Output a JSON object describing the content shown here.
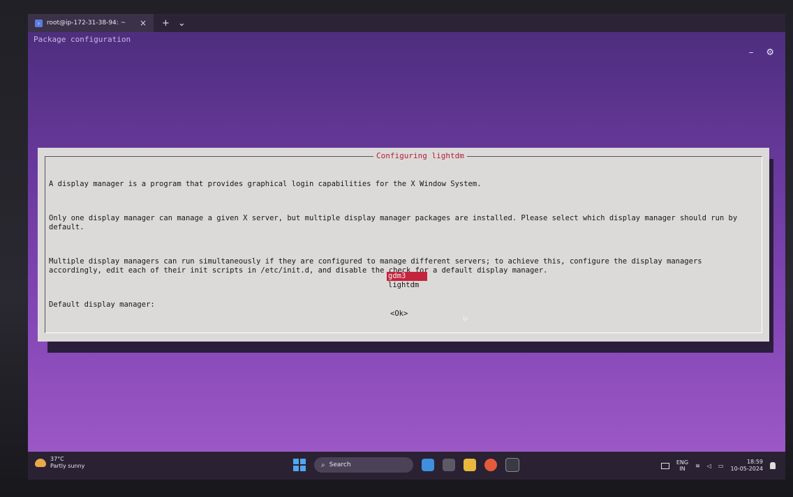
{
  "terminal": {
    "tab_title": "root@ip-172-31-38-94: ~",
    "tab_close": "×",
    "tab_new": "+",
    "tab_dropdown": "⌄",
    "header": "Package configuration",
    "minimize": "–",
    "settings": "⚙"
  },
  "dialog": {
    "title": "Configuring lightdm",
    "paragraph1": "A display manager is a program that provides graphical login capabilities for the X Window System.",
    "paragraph2": "Only one display manager can manage a given X server, but multiple display manager packages are installed. Please select which display manager should run by default.",
    "paragraph3": "Multiple display managers can run simultaneously if they are configured to manage different servers; to achieve this, configure the display managers accordingly, edit each of their init scripts in /etc/init.d, and disable the check for a default display manager.",
    "prompt": "Default display manager:",
    "options": [
      {
        "label": "gdm3",
        "selected": true
      },
      {
        "label": "lightdm",
        "selected": false
      }
    ],
    "ok_label": "<Ok>"
  },
  "taskbar": {
    "weather_temp": "37°C",
    "weather_desc": "Partly sunny",
    "search_label": "Search",
    "lang_top": "ENG",
    "lang_bottom": "IN",
    "time": "18:59",
    "date": "10-05-2024"
  },
  "colors": {
    "selection": "#c4243c",
    "dialog_title": "#b01e3a",
    "dialog_bg": "#dcdad8"
  }
}
